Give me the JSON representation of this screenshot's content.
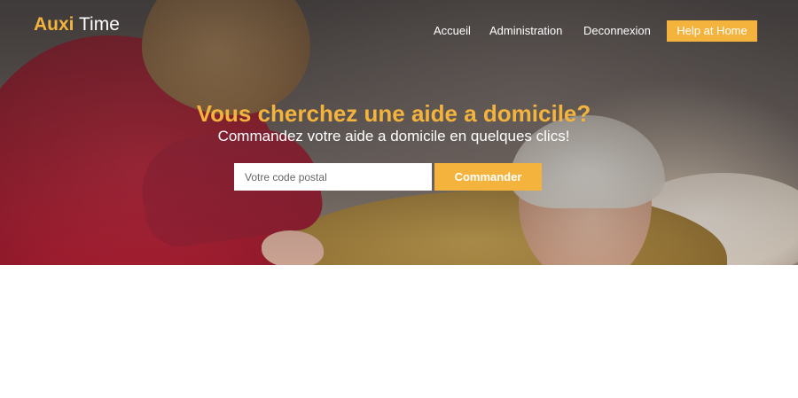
{
  "brand": {
    "name_accent": "Auxi",
    "name_rest": "Time",
    "accent_color": "#f3b33d"
  },
  "nav": {
    "items": [
      {
        "label": "Accueil"
      },
      {
        "label": "Administration"
      },
      {
        "label": "Deconnexion"
      }
    ],
    "cta_label": "Help at Home"
  },
  "hero": {
    "headline": "Vous cherchez une aide a domicile?",
    "subheadline": "Commandez votre aide a domicile en quelques clics!",
    "background_image": "photo-caregiver-with-elderly-woman",
    "search": {
      "placeholder": "Votre code postal",
      "value": ""
    },
    "submit_label": "Commander"
  }
}
